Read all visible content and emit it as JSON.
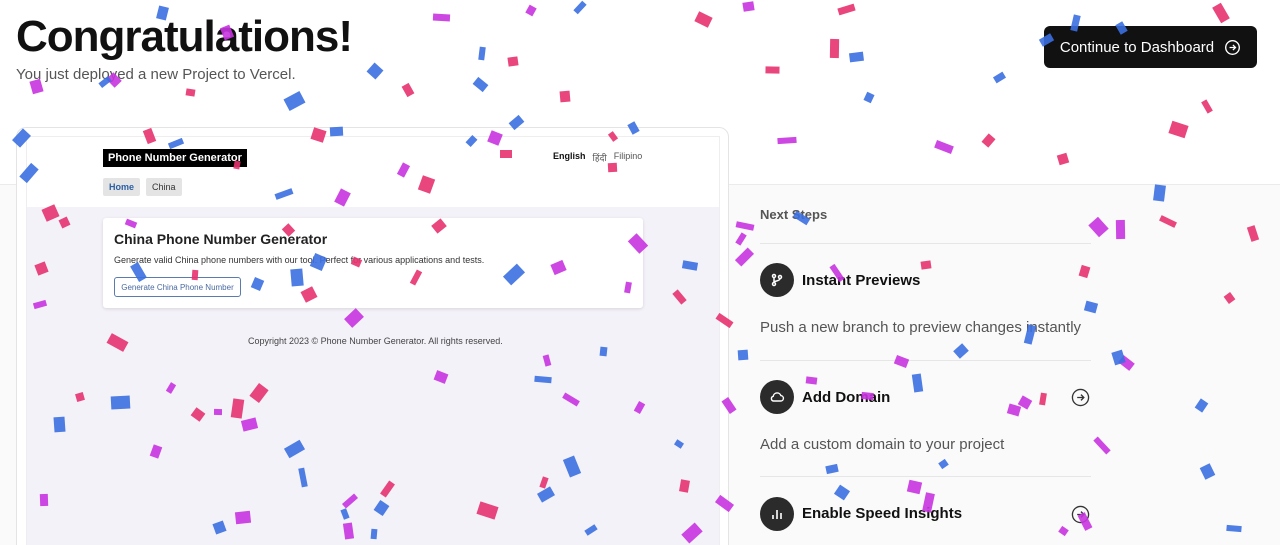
{
  "hero": {
    "title": "Congratulations!",
    "subtitle": "You just deployed a new Project to Vercel.",
    "cta_label": "Continue to Dashboard"
  },
  "preview": {
    "site_logo": "Phone Number Generator",
    "languages": [
      "English",
      "हिंदी",
      "Filipino"
    ],
    "nav": [
      "Home",
      "China"
    ],
    "card_title": "China Phone Number Generator",
    "card_text": "Generate valid China phone numbers with our tool. Perfect for various applications and tests.",
    "card_button": "Generate China Phone Number",
    "footer": "Copyright 2023 © Phone Number Generator. All rights reserved."
  },
  "next_steps": {
    "heading": "Next Steps",
    "items": [
      {
        "title": "Instant Previews",
        "description": "Push a new branch to preview changes instantly",
        "icon": "git-branch-icon"
      },
      {
        "title": "Add Domain",
        "description": "Add a custom domain to your project",
        "icon": "cloud-icon"
      },
      {
        "title": "Enable Speed Insights",
        "description": "",
        "icon": "bar-chart-icon"
      }
    ]
  },
  "colors": {
    "confetti_blue": "#3b6fe0",
    "confetti_pink": "#e5326f",
    "confetti_purple": "#c833e0",
    "button_bg": "#111111"
  }
}
